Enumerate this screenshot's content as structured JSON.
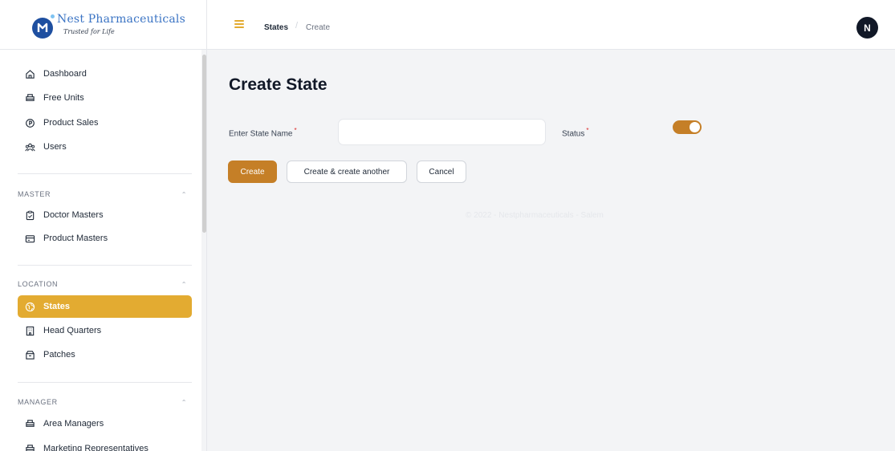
{
  "brand": {
    "name": "Nest Pharmaceuticals",
    "tagline": "Trusted for Life",
    "logo_color": "#1e4fa0",
    "text_color": "#3b74c4"
  },
  "sidebar": {
    "primary": [
      {
        "label": "Dashboard",
        "icon": "home-icon"
      },
      {
        "label": "Free Units",
        "icon": "printer-icon"
      },
      {
        "label": "Product Sales",
        "icon": "coin-icon"
      },
      {
        "label": "Users",
        "icon": "users-icon"
      }
    ],
    "sections": [
      {
        "label": "MASTER",
        "items": [
          {
            "label": "Doctor Masters",
            "icon": "clipboard-check-icon"
          },
          {
            "label": "Product Masters",
            "icon": "card-icon"
          }
        ]
      },
      {
        "label": "LOCATION",
        "items": [
          {
            "label": "States",
            "icon": "globe-icon",
            "active": true
          },
          {
            "label": "Head Quarters",
            "icon": "building-icon"
          },
          {
            "label": "Patches",
            "icon": "box-icon"
          }
        ]
      },
      {
        "label": "MANAGER",
        "items": [
          {
            "label": "Area Managers",
            "icon": "printer-icon"
          },
          {
            "label": "Marketing Representatives",
            "icon": "printer-icon"
          }
        ]
      }
    ]
  },
  "topbar": {
    "breadcrumb": [
      "States",
      "Create"
    ],
    "avatar_initial": "N"
  },
  "main": {
    "title": "Create State",
    "fields": {
      "state_name_label": "Enter State Name",
      "state_name_value": "",
      "status_label": "Status",
      "status_on": true,
      "required_mark": "*"
    },
    "buttons": {
      "create": "Create",
      "create_another": "Create & create another",
      "cancel": "Cancel"
    },
    "footer": "© 2022 - Nestpharmaceuticals - Salem"
  },
  "colors": {
    "accent": "#e3ab31",
    "primary_button": "#c57f27",
    "background": "#f3f4f6"
  }
}
